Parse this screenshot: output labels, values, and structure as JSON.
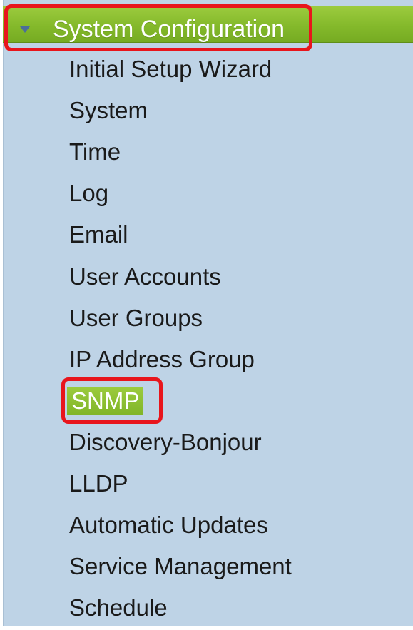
{
  "nav": {
    "section": {
      "title": "System Configuration",
      "expanded": true,
      "icon": "chevron-down-icon",
      "color": "#84b92b"
    },
    "items": [
      {
        "label": "Initial Setup Wizard",
        "slug": "initial-setup-wizard"
      },
      {
        "label": "System",
        "slug": "system"
      },
      {
        "label": "Time",
        "slug": "time"
      },
      {
        "label": "Log",
        "slug": "log"
      },
      {
        "label": "Email",
        "slug": "email"
      },
      {
        "label": "User Accounts",
        "slug": "user-accounts"
      },
      {
        "label": "User Groups",
        "slug": "user-groups"
      },
      {
        "label": "IP Address Group",
        "slug": "ip-address-group"
      },
      {
        "label": "SNMP",
        "slug": "snmp"
      },
      {
        "label": "Discovery-Bonjour",
        "slug": "discovery-bonjour"
      },
      {
        "label": "LLDP",
        "slug": "lldp"
      },
      {
        "label": "Automatic Updates",
        "slug": "automatic-updates"
      },
      {
        "label": "Service Management",
        "slug": "service-management"
      },
      {
        "label": "Schedule",
        "slug": "schedule"
      }
    ],
    "selected_index": 8
  },
  "annotations": {
    "highlight_color": "#e8151c"
  },
  "theme": {
    "panel_background": "#bed3e6",
    "active_green": "#84b92b",
    "text_color": "#1a1a1a"
  }
}
